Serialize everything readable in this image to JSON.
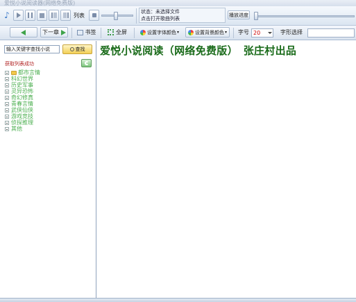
{
  "window": {
    "title": "爱悦小说阅读器(网络免费版)"
  },
  "player": {
    "list_label": "列表",
    "status_line1": "状态：未选择文件",
    "status_line2": "点击打开歌曲列表",
    "progress_label": "播放进度",
    "volume_level": 0.45,
    "progress_level": 0.0
  },
  "reader_toolbar": {
    "prev_label": "",
    "next_label": "下一章",
    "bookmark_label": "书签",
    "fullscreen_label": "全屏",
    "font_color_label": "设置字体颜色",
    "bg_color_label": "设置背景颜色",
    "font_size_label": "字号",
    "font_size_value": "20",
    "font_style_label": "字形选择",
    "font_style_value": ""
  },
  "sidebar": {
    "search_placeholder": "输入关键字查找小说",
    "search_button": "查找",
    "fetch_status": "获取列表成功",
    "categories": [
      "都市言情",
      "科幻世界",
      "历史军事",
      "灵异恐怖",
      "奇幻修真",
      "青春言情",
      "武侠仙侠",
      "游戏竞技",
      "侦探推理",
      "其他"
    ]
  },
  "content": {
    "heading": "爱悦小说阅读（网络免费版）　张庄村出品"
  },
  "colors": {
    "heading_text": "#1a6b1a",
    "category_text": "#4caf50",
    "status_text": "#b02020",
    "font_size_value": "#cc0000"
  },
  "icons": {
    "app": "music-note-icon",
    "refresh": "refresh-icon",
    "search": "magnifier-icon"
  }
}
